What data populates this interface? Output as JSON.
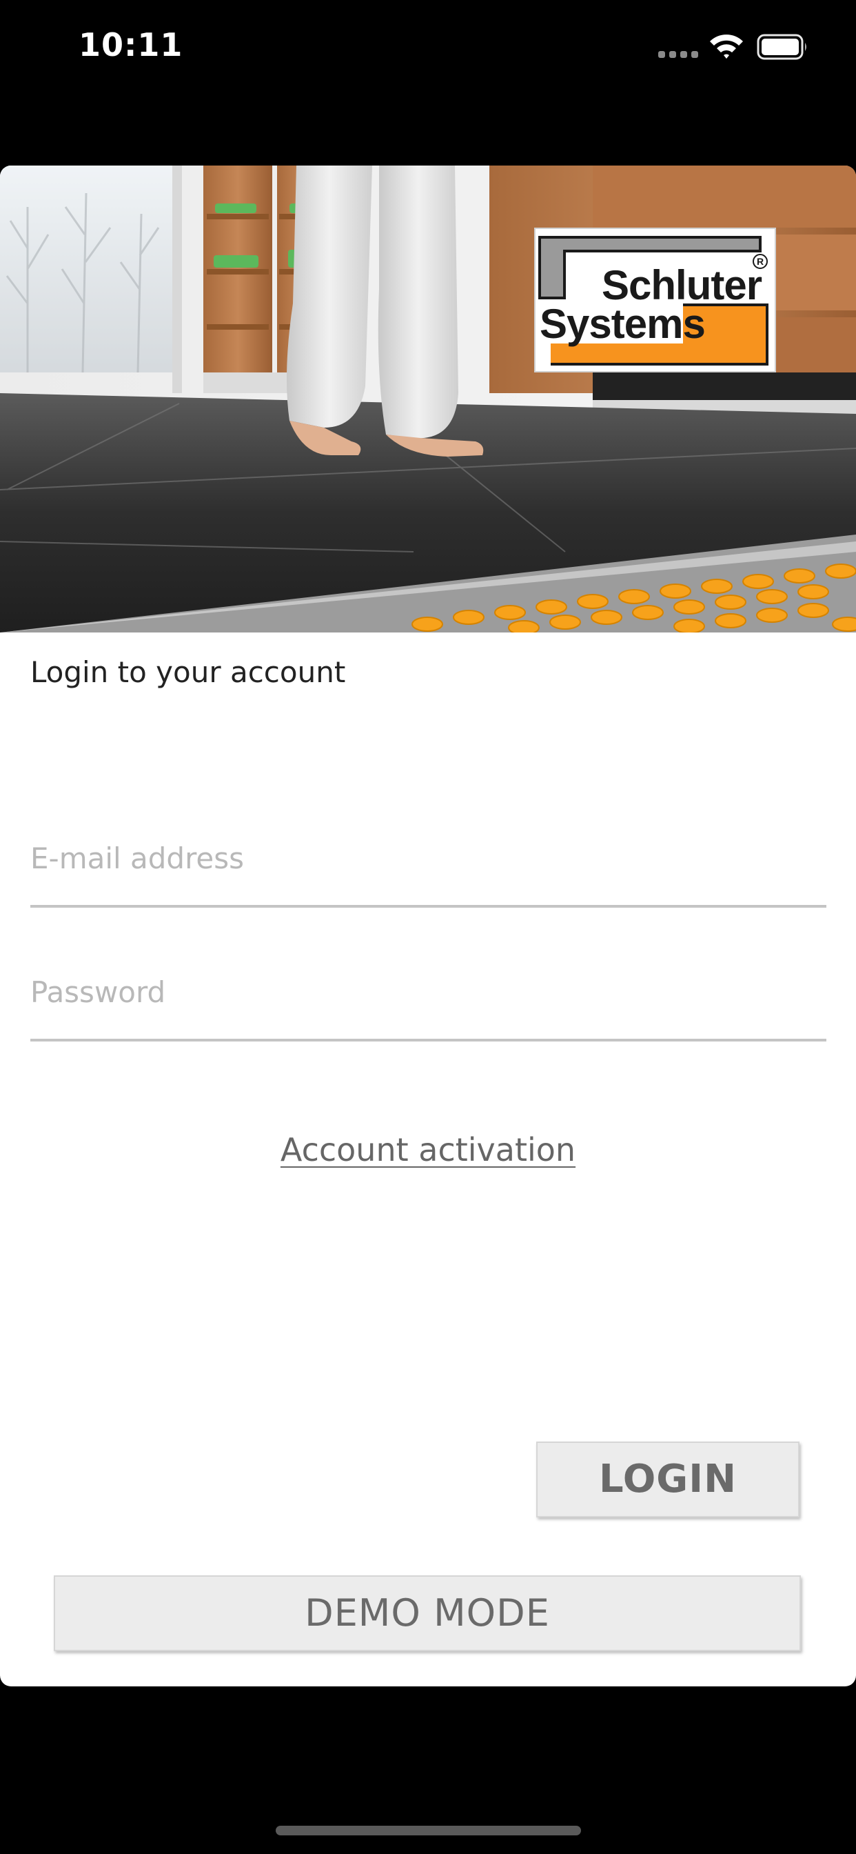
{
  "status_bar": {
    "time": "10:11"
  },
  "logo": {
    "word1": "Schluter",
    "word2": "Systems",
    "registered": "R",
    "accent_color": "#f7931e"
  },
  "form": {
    "title": "Login to your account",
    "email_placeholder": "E-mail address",
    "password_placeholder": "Password",
    "activation_link": "Account activation"
  },
  "buttons": {
    "login_label": "LOGIN",
    "demo_label": "DEMO MODE"
  },
  "icons": {
    "signal": "cellular-signal-icon",
    "wifi": "wifi-icon",
    "battery": "battery-icon"
  }
}
